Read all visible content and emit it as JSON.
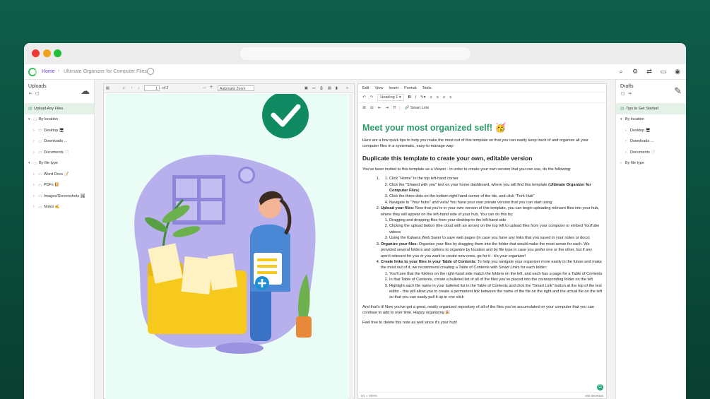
{
  "appbar": {
    "home": "Home",
    "separator": "›",
    "page_title": "Ultimate Organizer for Computer Files"
  },
  "left_sidebar": {
    "title": "Uploads",
    "items": [
      {
        "label": "Upload Any Files",
        "icon": "document-icon",
        "selected": true
      },
      {
        "label": "By location",
        "icon": "folder-icon"
      },
      {
        "label": "Desktop 🖥",
        "icon": "folder-icon"
      },
      {
        "label": "Downloads ...",
        "icon": "folder-icon"
      },
      {
        "label": "Documents 📄",
        "icon": "folder-icon"
      },
      {
        "label": "By file type",
        "icon": "folder-icon"
      },
      {
        "label": "Word Docs 📝",
        "icon": "folder-icon"
      },
      {
        "label": "PDFs 📔",
        "icon": "folder-icon"
      },
      {
        "label": "Images/Screenshots 🖼",
        "icon": "folder-icon"
      },
      {
        "label": "Notes ✍",
        "icon": "folder-icon"
      }
    ]
  },
  "right_sidebar": {
    "title": "Drafts",
    "items": [
      {
        "label": "Tips to Get Started",
        "selected": true
      },
      {
        "label": "By location"
      },
      {
        "label": "Desktop 🖥"
      },
      {
        "label": "Downloads ..."
      },
      {
        "label": "Documents 📄"
      },
      {
        "label": "By file type"
      }
    ]
  },
  "pdf_viewer": {
    "page_number": "1",
    "page_total": "of 2",
    "zoom": "Automatic Zoom",
    "zoom_minus": "—",
    "zoom_plus": "+"
  },
  "editor": {
    "menu": [
      "Edit",
      "View",
      "Insert",
      "Format",
      "Tools"
    ],
    "heading_select": "Heading 1",
    "smart_link": "Smart Link",
    "title": "Meet your most organized self! 🥳",
    "intro": "Here are a few quick tips to help you make the most out of this template so that you can easily keep track of and organize all your computer files in a systematic, easy-to-manage way:",
    "h2": "Duplicate this template to create your own, editable version",
    "p1": "You've been invited to this template as a Viewer - in order to create your own version that you can use, do the following:",
    "step1": {
      "sub": [
        "Click \"Home\" in the top left-hand corner",
        "Click the \"Shared with you\" text on your home dashboard, where you will find this template (",
        "Ultimate Organizer for Computer Files",
        ")",
        "Click the three dots on the bottom right-hand corner of the tile, and click \"Fork Hub\"",
        "Navigate to \"Your hubs\" and voila! You have your own private version that you can start using"
      ]
    },
    "step2": {
      "bold": "Upload your files:",
      "text": " Now that you're in your own version of this template, you can begin uploading relevant files into your hub, where they will appear on the left-hand side of your hub. You can do this by:",
      "sub": [
        "Dragging and dropping files from your desktop to the left-hand side",
        "Clicking the upload button (the cloud with an arrow) on the top left to upload files from your computer or embed YouTube videos",
        "Using the Kahana Web Saver to save web pages (in case you have any links that you saved in your notes or docs)"
      ]
    },
    "step3": {
      "bold": "Organize your files:",
      "text": " Organize your files by dragging them into the folder that would make the most sense for each. We provided several folders and options to organize by location and by file type in case you prefer one or the other, but if any aren't relevant for you or you want to create new ones, go for it - it's your organizer!"
    },
    "step4": {
      "bold": "Create links to your files in your Table of Contents:",
      "text": " To help you navigate your organizer more easily in the future and make the most out of it, we recommend creating a Table of Contents with ",
      "italic": "Smart Links",
      "text2": " for each folder:",
      "sub": [
        "You'll see that the folders on the right-hand side match the folders on the left, and each has a page for a Table of Contents",
        "In that Table of Contents, create a bulleted list of all of the files you've placed into the corresponding folder on the left",
        "Highlight each file name in your bulleted list in the Table of Contents and click the \"Smart Link\" button at the top of the text editor - this will allow you to create a permanent link between the name of the file on the right and the actual file on the left so that you can easily pull it up in one click"
      ]
    },
    "outro1": "And that's it! Now you've got a great, neatly organized repository of all of the files you've accumulated on your computer that you can continue to add to over time. Happy organizing 🎉",
    "outro2": "Feel free to delete this note as well since it's your hub!",
    "status_left": "H1 » SPAN",
    "status_right": "469 WORDS",
    "badge": "G"
  },
  "colors": {
    "background": "#0f5e4a",
    "accent_green": "#2f9e6a",
    "link_purple": "#6a3ce0",
    "selected_bg": "#e3f1e6"
  }
}
